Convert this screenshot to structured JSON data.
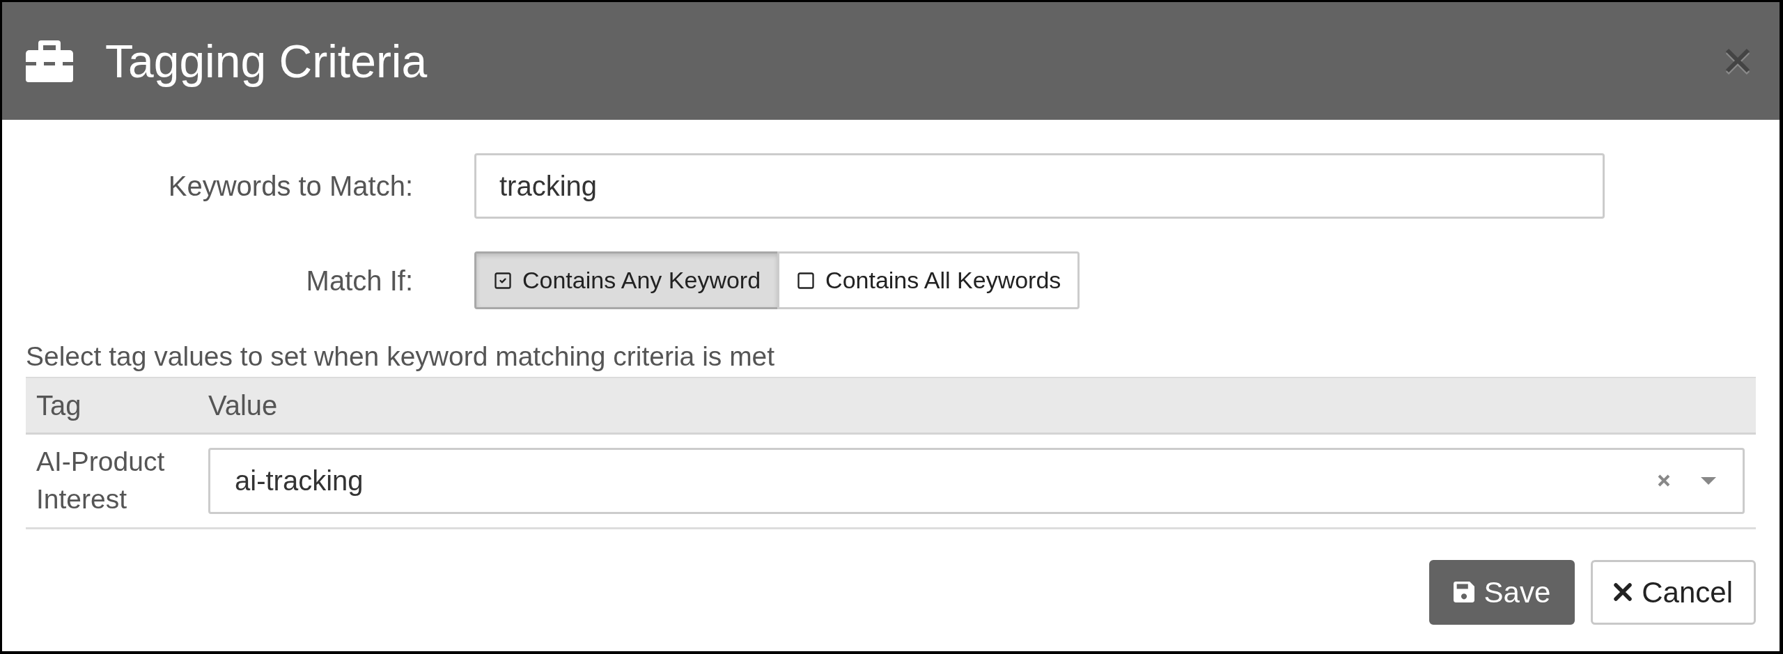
{
  "dialog": {
    "title": "Tagging Criteria"
  },
  "keywords": {
    "label": "Keywords to Match:",
    "value": "tracking"
  },
  "match_if": {
    "label": "Match If:",
    "options": [
      {
        "label": "Contains Any Keyword",
        "selected": true
      },
      {
        "label": "Contains All Keywords",
        "selected": false
      }
    ]
  },
  "instructions": "Select tag values to set when keyword matching criteria is met",
  "table": {
    "columns": [
      "Tag",
      "Value"
    ],
    "rows": [
      {
        "tag": "AI-Product Interest",
        "value": "ai-tracking"
      }
    ]
  },
  "buttons": [
    {
      "label": "Save",
      "kind": "primary"
    },
    {
      "label": "Cancel",
      "kind": "secondary"
    }
  ]
}
